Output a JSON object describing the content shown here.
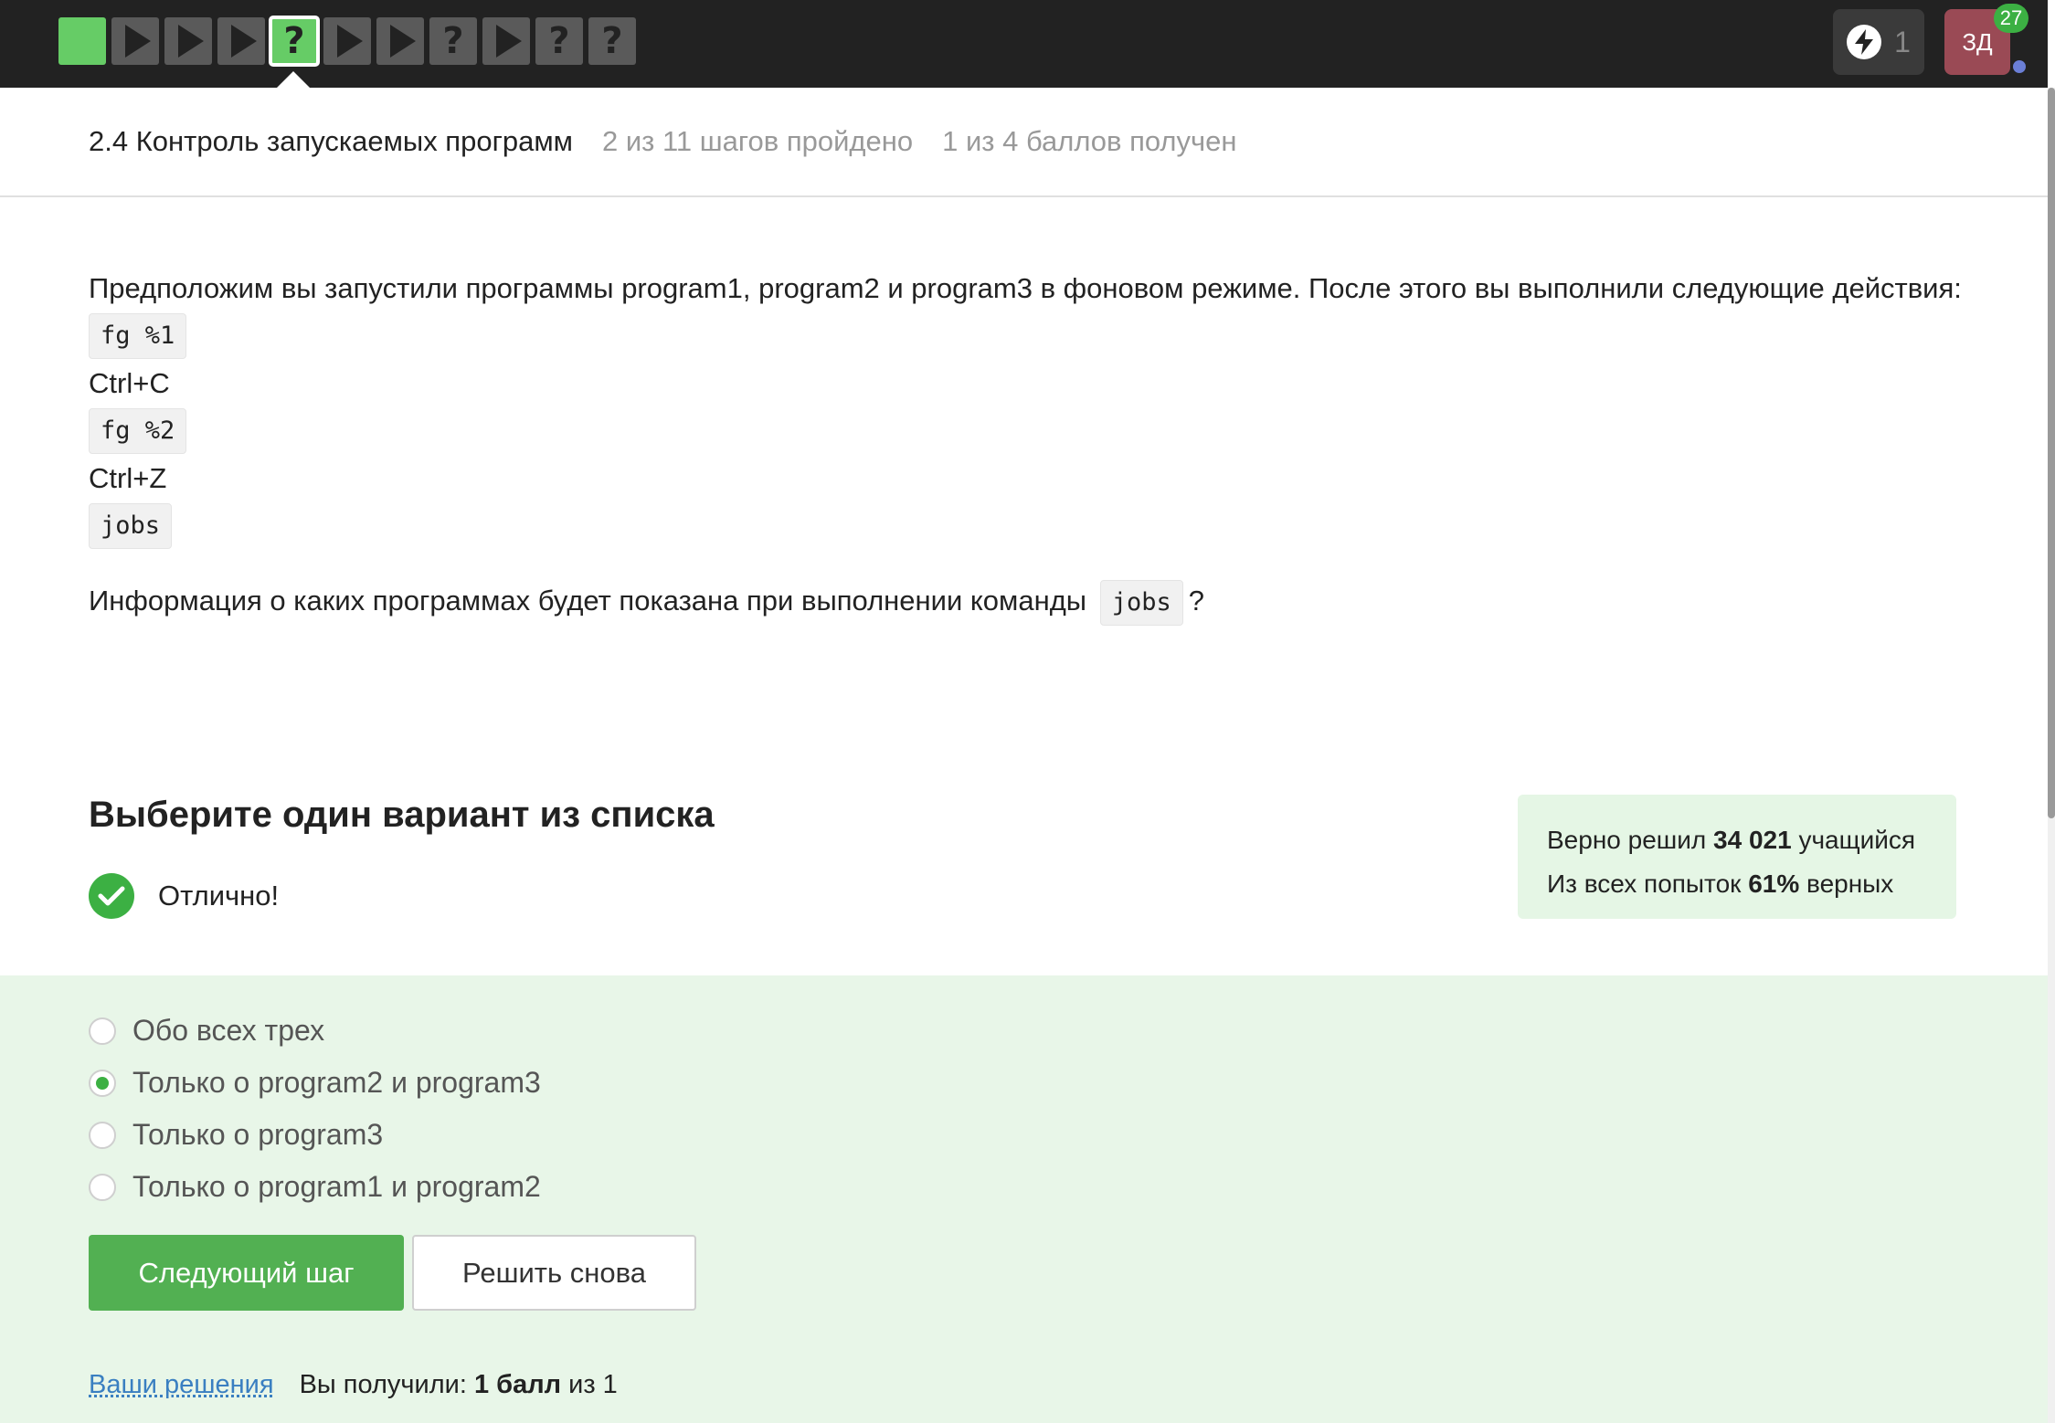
{
  "navbar": {
    "steps": [
      {
        "state": "done",
        "icon": "square"
      },
      {
        "state": "todo",
        "icon": "play-icon"
      },
      {
        "state": "todo",
        "icon": "play-icon"
      },
      {
        "state": "todo",
        "icon": "play-icon"
      },
      {
        "state": "current",
        "icon": "question-icon",
        "glyph": "?"
      },
      {
        "state": "todo",
        "icon": "play-icon"
      },
      {
        "state": "todo",
        "icon": "play-icon"
      },
      {
        "state": "todo",
        "icon": "question-icon",
        "glyph": "?"
      },
      {
        "state": "todo",
        "icon": "play-icon"
      },
      {
        "state": "todo",
        "icon": "question-icon",
        "glyph": "?"
      },
      {
        "state": "todo",
        "icon": "question-icon",
        "glyph": "?"
      }
    ],
    "energy_count": "1",
    "avatar_initials": "ЗД",
    "notification_count": "27"
  },
  "header": {
    "lesson_title": "2.4 Контроль запускаемых программ",
    "steps_progress": "2 из 11 шагов пройдено",
    "points_progress": "1 из 4 баллов  получен"
  },
  "task": {
    "intro": "Предположим вы запустили программы program1, program2 и program3 в фоновом режиме. После этого вы выполнили следующие действия:",
    "actions": [
      {
        "type": "code",
        "text": "fg %1"
      },
      {
        "type": "text",
        "text": "Ctrl+C"
      },
      {
        "type": "code",
        "text": "fg %2"
      },
      {
        "type": "text",
        "text": "Ctrl+Z"
      },
      {
        "type": "code",
        "text": "jobs"
      }
    ],
    "question_before": "Информация о каких программах будет показана при выполнении команды",
    "question_code": "jobs",
    "question_after": "?"
  },
  "quiz": {
    "section_title": "Выберите один вариант из списка",
    "result_text": "Отлично!",
    "options": [
      {
        "label": "Обо всех трех",
        "selected": false
      },
      {
        "label": "Только о program2 и program3",
        "selected": true
      },
      {
        "label": "Только о program3",
        "selected": false
      },
      {
        "label": "Только о program1 и program2",
        "selected": false
      }
    ],
    "next_button": "Следующий шаг",
    "retry_button": "Решить снова"
  },
  "stats": {
    "solved_prefix": "Верно решил",
    "solved_count": "34 021",
    "solved_suffix": "учащийся",
    "attempts_prefix": "Из всех попыток",
    "attempts_percent": "61%",
    "attempts_suffix": "верных"
  },
  "footer": {
    "solutions_link": "Ваши решения",
    "score_prefix": "Вы получили:",
    "score_value": "1 балл",
    "score_suffix": "из 1"
  },
  "colors": {
    "accent_green": "#52b052",
    "navbar_bg": "#222222",
    "answer_bg": "#e8f6e8",
    "link": "#3a7fc1"
  }
}
